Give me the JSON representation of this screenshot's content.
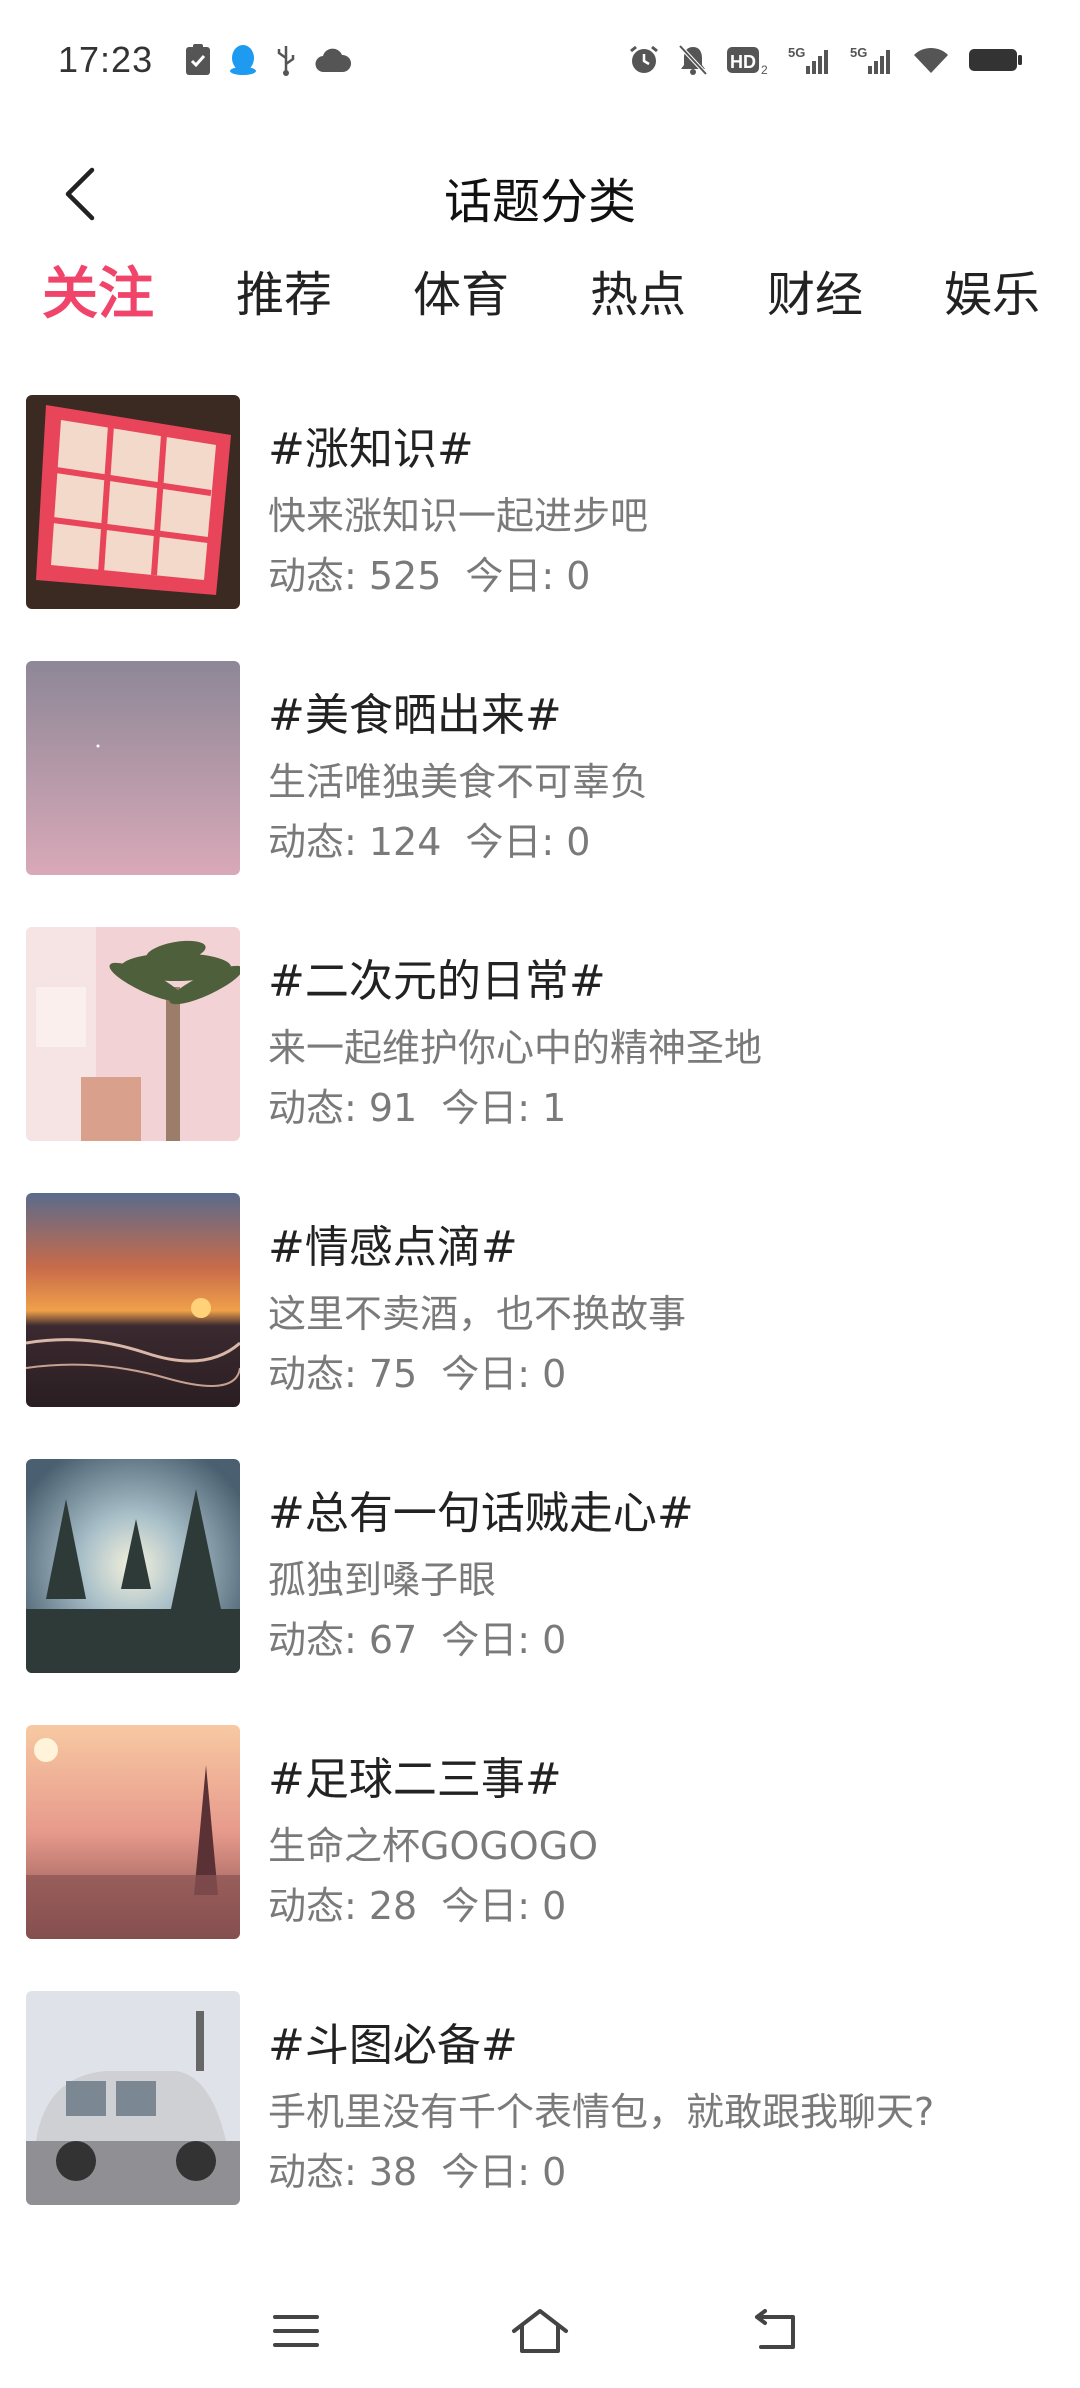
{
  "status_bar": {
    "time": "17:23",
    "left_icons": [
      "check-clipboard-icon",
      "qq-penguin-icon",
      "usb-icon",
      "cloud-icon"
    ],
    "right_icons": [
      "alarm-icon",
      "mute-bell-icon",
      "hd-icon",
      "signal-5g-icon",
      "signal-5g-icon",
      "wifi-icon",
      "battery-icon"
    ],
    "hd_label": "HD",
    "hd_sub": "2",
    "net_label_1": "5G",
    "net_label_2": "5G"
  },
  "header": {
    "title": "话题分类",
    "back_icon": "chevron-left-icon"
  },
  "tabs": [
    {
      "label": "关注",
      "active": true
    },
    {
      "label": "推荐",
      "active": false
    },
    {
      "label": "体育",
      "active": false
    },
    {
      "label": "热点",
      "active": false
    },
    {
      "label": "财经",
      "active": false
    },
    {
      "label": "娱乐",
      "active": false
    }
  ],
  "topics": [
    {
      "title": "#涨知识#",
      "desc": "快来涨知识一起进步吧",
      "posts_label": "动态: 525",
      "today_label": "今日: 0"
    },
    {
      "title": "#美食晒出来#",
      "desc": "生活唯独美食不可辜负",
      "posts_label": "动态: 124",
      "today_label": "今日: 0"
    },
    {
      "title": "#二次元的日常#",
      "desc": "来一起维护你心中的精神圣地",
      "posts_label": "动态: 91",
      "today_label": "今日: 1"
    },
    {
      "title": "#情感点滴#",
      "desc": "这里不卖酒，也不换故事",
      "posts_label": "动态: 75",
      "today_label": "今日: 0"
    },
    {
      "title": "#总有一句话贼走心#",
      "desc": "孤独到嗓子眼",
      "posts_label": "动态: 67",
      "today_label": "今日: 0"
    },
    {
      "title": "#足球二三事#",
      "desc": "生命之杯GOGOGO",
      "posts_label": "动态: 28",
      "today_label": "今日: 0"
    },
    {
      "title": "#斗图必备#",
      "desc": "手机里没有千个表情包，就敢跟我聊天?",
      "posts_label": "动态: 38",
      "today_label": "今日: 0"
    }
  ],
  "colors": {
    "active_tab": "#f0446a",
    "text_primary": "#222222",
    "text_secondary": "#7a7a7a"
  },
  "nav_bar": {
    "icons": [
      "menu-icon",
      "home-icon",
      "back-icon"
    ]
  }
}
